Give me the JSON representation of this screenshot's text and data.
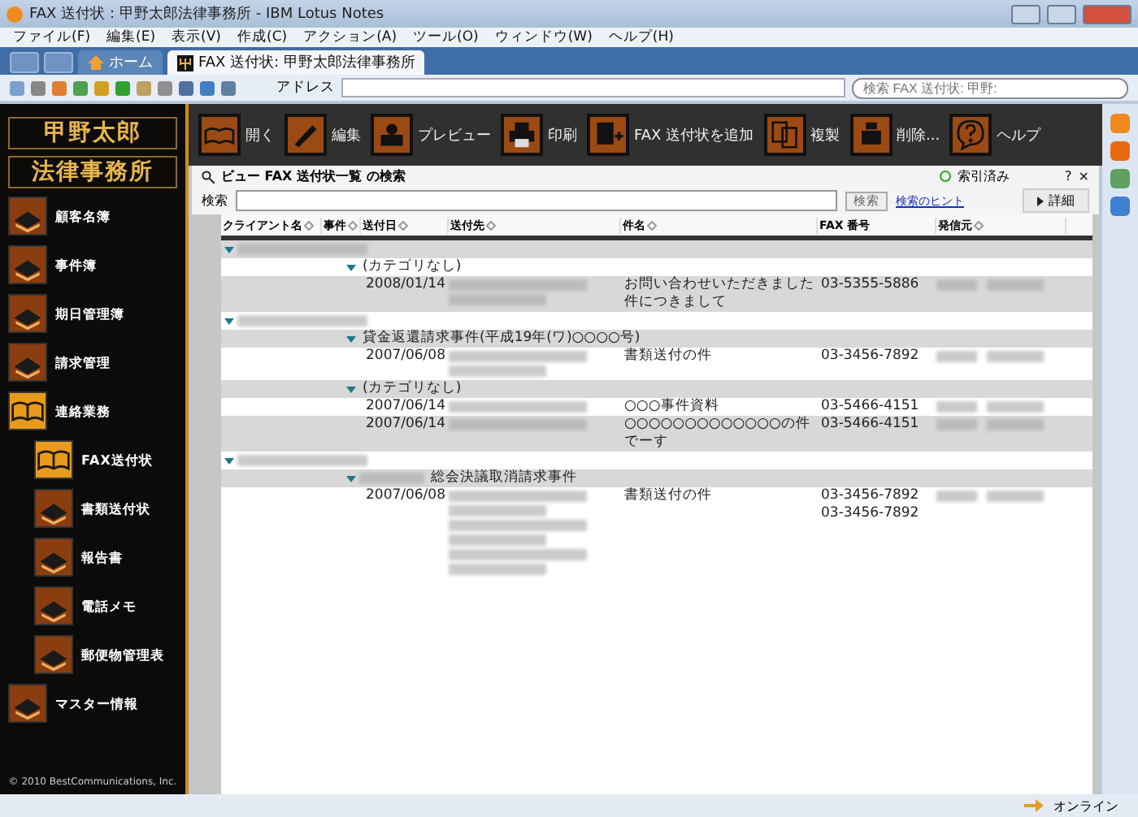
{
  "window": {
    "title": "FAX 送付状：甲野太郎法律事務所 - IBM Lotus Notes"
  },
  "menu": [
    "ファイル(F)",
    "編集(E)",
    "表示(V)",
    "作成(C)",
    "アクション(A)",
    "ツール(O)",
    "ウィンドウ(W)",
    "ヘルプ(H)"
  ],
  "tabs": [
    {
      "label": "ホーム",
      "selected": false,
      "kind": "home"
    },
    {
      "label": "FAX 送付状: 甲野太郎法律事務所",
      "selected": true,
      "kind": "doc"
    }
  ],
  "address": {
    "label": "アドレス"
  },
  "search_box": {
    "placeholder": "検索 FAX 送付状: 甲野:"
  },
  "logo": {
    "line1": "甲野太郎",
    "line2": "法律事務所"
  },
  "sidebar": {
    "items": [
      {
        "label": "顧客名簿",
        "selected": false
      },
      {
        "label": "事件簿",
        "selected": false
      },
      {
        "label": "期日管理簿",
        "selected": false
      },
      {
        "label": "請求管理",
        "selected": false
      },
      {
        "label": "連絡業務",
        "selected": true,
        "children": [
          {
            "label": "FAX送付状",
            "selected": true
          },
          {
            "label": "書類送付状",
            "selected": false
          },
          {
            "label": "報告書",
            "selected": false
          },
          {
            "label": "電話メモ",
            "selected": false
          },
          {
            "label": "郵便物管理表",
            "selected": false
          }
        ]
      },
      {
        "label": "マスター情報",
        "selected": false
      }
    ],
    "copyright": "© 2010 BestCommunications, Inc."
  },
  "actions": [
    {
      "label": "開く",
      "kind": "open"
    },
    {
      "label": "編集",
      "kind": "edit"
    },
    {
      "label": "プレビュー",
      "kind": "preview"
    },
    {
      "label": "印刷",
      "kind": "print"
    },
    {
      "label": "FAX 送付状を追加",
      "kind": "add"
    },
    {
      "label": "複製",
      "kind": "copy"
    },
    {
      "label": "削除...",
      "kind": "delete"
    },
    {
      "label": "ヘルプ",
      "kind": "help"
    }
  ],
  "view": {
    "title": "ビュー FAX 送付状一覧 の検索",
    "index_status": "索引済み",
    "help": "?",
    "close": "×",
    "search_label": "検索",
    "search_button": "検索",
    "hint_link": "検索のヒント",
    "details": "詳細",
    "columns": [
      {
        "label": "クライアント名",
        "sortable": true
      },
      {
        "label": "事件",
        "sortable": true
      },
      {
        "label": "送付日",
        "sortable": true
      },
      {
        "label": "送付先",
        "sortable": true
      },
      {
        "label": "件名",
        "sortable": true
      },
      {
        "label": "FAX 番号",
        "sortable": false
      },
      {
        "label": "発信元",
        "sortable": true
      }
    ],
    "rows": [
      {
        "kind": "group"
      },
      {
        "kind": "category",
        "label": "(カテゴリなし)"
      },
      {
        "kind": "doc",
        "date": "2008/01/14",
        "recipient": [
          {
            "kind": "redacted"
          },
          {
            "kind": "redacted"
          }
        ],
        "subject": "お問い合わせいただきました件につきまして",
        "fax": [
          "03-5355-5886"
        ]
      },
      {
        "kind": "group"
      },
      {
        "kind": "category",
        "label": "貸金返還請求事件(平成19年(ワ)○○○○号)"
      },
      {
        "kind": "doc",
        "date": "2007/06/08",
        "recipient": [
          {
            "kind": "redacted"
          },
          {
            "kind": "redacted"
          }
        ],
        "subject": "書類送付の件",
        "fax": [
          "03-3456-7892"
        ]
      },
      {
        "kind": "category",
        "label": "(カテゴリなし)"
      },
      {
        "kind": "doc",
        "date": "2007/06/14",
        "recipient": [
          {
            "kind": "redacted"
          }
        ],
        "subject": "○○○事件資料",
        "fax": [
          "03-5466-4151"
        ]
      },
      {
        "kind": "doc",
        "date": "2007/06/14",
        "recipient": [
          {
            "kind": "redacted"
          }
        ],
        "subject": "○○○○○○○○○○○○○の件でーす",
        "fax": [
          "03-5466-4151"
        ]
      },
      {
        "kind": "group"
      },
      {
        "kind": "category_redacted",
        "label": "総会決議取消請求事件"
      },
      {
        "kind": "doc",
        "date": "2007/06/08",
        "recipient": [
          {
            "kind": "redacted"
          },
          {
            "kind": "redacted"
          },
          {
            "kind": "redacted"
          },
          {
            "kind": "redacted"
          },
          {
            "kind": "redacted"
          },
          {
            "kind": "redacted"
          }
        ],
        "subject": "書類送付の件",
        "fax": [
          "03-3456-7892",
          "03-3456-7892"
        ]
      }
    ]
  },
  "status_bar": {
    "text": "オンライン"
  }
}
